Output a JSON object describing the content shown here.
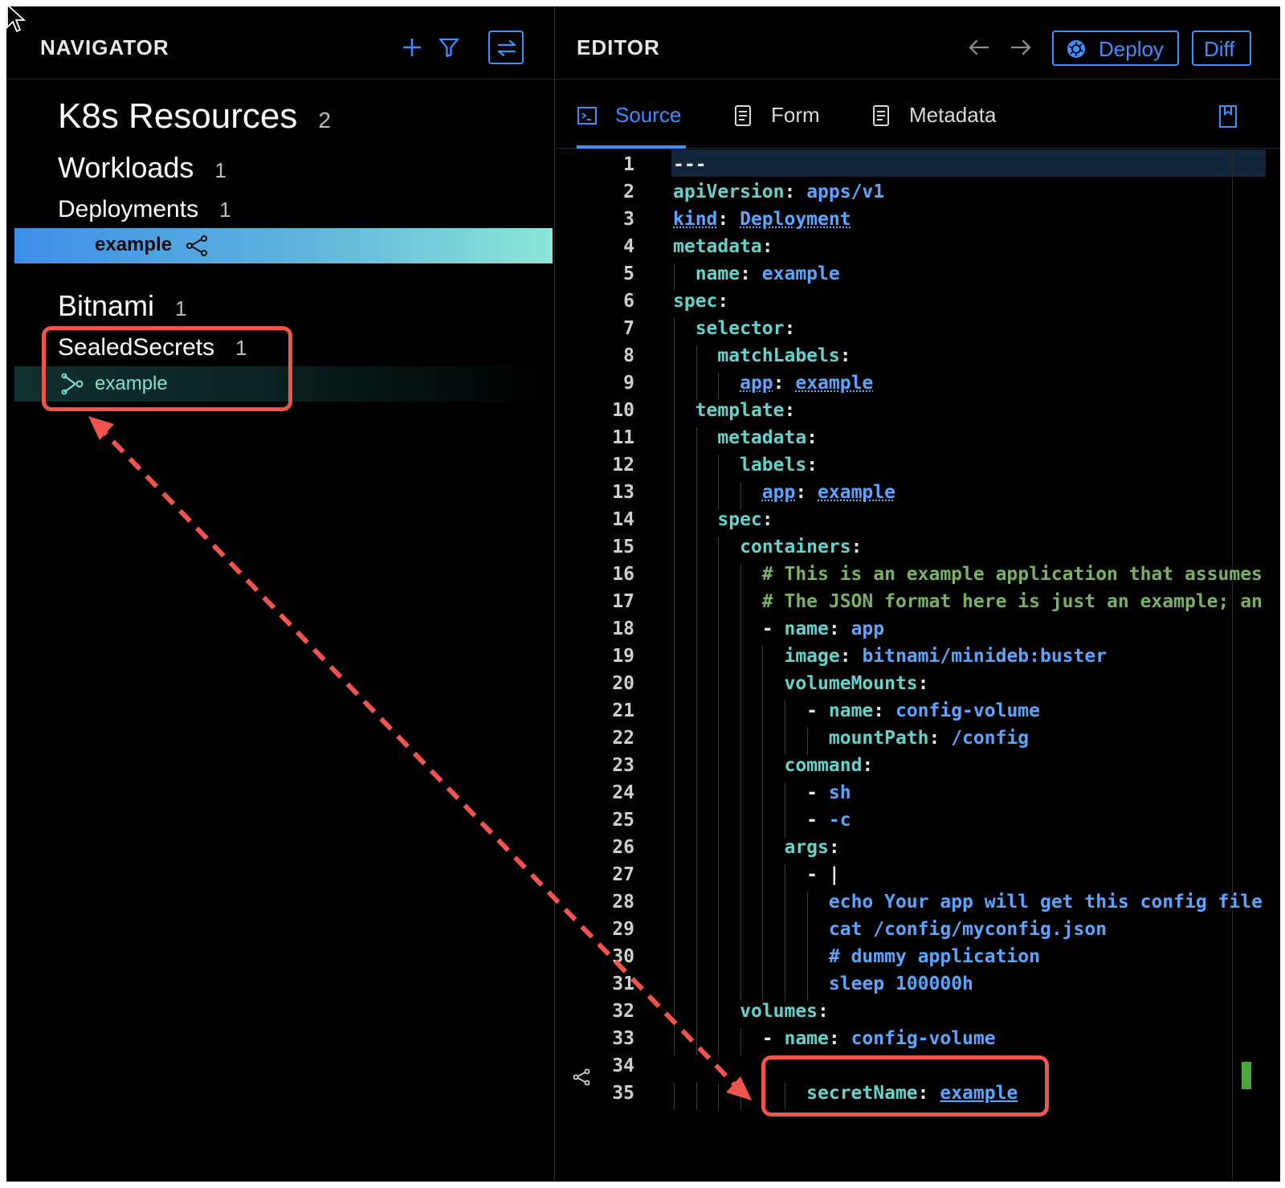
{
  "navigator": {
    "title": "NAVIGATOR",
    "section": {
      "title": "K8s Resources",
      "count": "2"
    },
    "groups": [
      {
        "title": "Workloads",
        "count": "1",
        "kinds": [
          {
            "title": "Deployments",
            "count": "1",
            "items": [
              "example"
            ]
          }
        ]
      },
      {
        "title": "Bitnami",
        "count": "1",
        "kinds": [
          {
            "title": "SealedSecrets",
            "count": "1",
            "items": [
              "example"
            ]
          }
        ]
      }
    ]
  },
  "editor": {
    "title": "EDITOR",
    "deploy_label": "Deploy",
    "diff_label": "Diff",
    "tabs": [
      {
        "label": "Source",
        "active": true
      },
      {
        "label": "Form",
        "active": false
      },
      {
        "label": "Metadata",
        "active": false
      }
    ],
    "lines": [
      {
        "n": "1",
        "segs": [
          [
            "p",
            "---"
          ]
        ]
      },
      {
        "n": "2",
        "segs": [
          [
            "k",
            "apiVersion"
          ],
          [
            "p",
            ": "
          ],
          [
            "v",
            "apps/v1"
          ]
        ]
      },
      {
        "n": "3",
        "segs": [
          [
            "u",
            "kind"
          ],
          [
            "p",
            ": "
          ],
          [
            "u",
            "Deployment"
          ]
        ]
      },
      {
        "n": "4",
        "segs": [
          [
            "k",
            "metadata"
          ],
          [
            "p",
            ":"
          ]
        ]
      },
      {
        "n": "5",
        "segs": [
          [
            "p",
            "  "
          ],
          [
            "k",
            "name"
          ],
          [
            "p",
            ": "
          ],
          [
            "v",
            "example"
          ]
        ]
      },
      {
        "n": "6",
        "segs": [
          [
            "k",
            "spec"
          ],
          [
            "p",
            ":"
          ]
        ]
      },
      {
        "n": "7",
        "segs": [
          [
            "p",
            "  "
          ],
          [
            "k",
            "selector"
          ],
          [
            "p",
            ":"
          ]
        ]
      },
      {
        "n": "8",
        "segs": [
          [
            "p",
            "    "
          ],
          [
            "k",
            "matchLabels"
          ],
          [
            "p",
            ":"
          ]
        ]
      },
      {
        "n": "9",
        "segs": [
          [
            "p",
            "      "
          ],
          [
            "u",
            "app"
          ],
          [
            "p",
            ": "
          ],
          [
            "u",
            "example"
          ]
        ]
      },
      {
        "n": "10",
        "segs": [
          [
            "p",
            "  "
          ],
          [
            "k",
            "template"
          ],
          [
            "p",
            ":"
          ]
        ]
      },
      {
        "n": "11",
        "segs": [
          [
            "p",
            "    "
          ],
          [
            "k",
            "metadata"
          ],
          [
            "p",
            ":"
          ]
        ]
      },
      {
        "n": "12",
        "segs": [
          [
            "p",
            "      "
          ],
          [
            "k",
            "labels"
          ],
          [
            "p",
            ":"
          ]
        ]
      },
      {
        "n": "13",
        "segs": [
          [
            "p",
            "        "
          ],
          [
            "u",
            "app"
          ],
          [
            "p",
            ": "
          ],
          [
            "u",
            "example"
          ]
        ]
      },
      {
        "n": "14",
        "segs": [
          [
            "p",
            "    "
          ],
          [
            "k",
            "spec"
          ],
          [
            "p",
            ":"
          ]
        ]
      },
      {
        "n": "15",
        "segs": [
          [
            "p",
            "      "
          ],
          [
            "k",
            "containers"
          ],
          [
            "p",
            ":"
          ]
        ]
      },
      {
        "n": "16",
        "segs": [
          [
            "p",
            "        "
          ],
          [
            "c",
            "# This is an example application that assumes"
          ]
        ]
      },
      {
        "n": "17",
        "segs": [
          [
            "p",
            "        "
          ],
          [
            "c",
            "# The JSON format here is just an example; an"
          ]
        ]
      },
      {
        "n": "18",
        "segs": [
          [
            "p",
            "        - "
          ],
          [
            "k",
            "name"
          ],
          [
            "p",
            ": "
          ],
          [
            "v",
            "app"
          ]
        ]
      },
      {
        "n": "19",
        "segs": [
          [
            "p",
            "          "
          ],
          [
            "k",
            "image"
          ],
          [
            "p",
            ": "
          ],
          [
            "v",
            "bitnami/minideb:buster"
          ]
        ]
      },
      {
        "n": "20",
        "segs": [
          [
            "p",
            "          "
          ],
          [
            "k",
            "volumeMounts"
          ],
          [
            "p",
            ":"
          ]
        ]
      },
      {
        "n": "21",
        "segs": [
          [
            "p",
            "            - "
          ],
          [
            "k",
            "name"
          ],
          [
            "p",
            ": "
          ],
          [
            "v",
            "config-volume"
          ]
        ]
      },
      {
        "n": "22",
        "segs": [
          [
            "p",
            "              "
          ],
          [
            "k",
            "mountPath"
          ],
          [
            "p",
            ": "
          ],
          [
            "v",
            "/config"
          ]
        ]
      },
      {
        "n": "23",
        "segs": [
          [
            "p",
            "          "
          ],
          [
            "k",
            "command"
          ],
          [
            "p",
            ":"
          ]
        ]
      },
      {
        "n": "24",
        "segs": [
          [
            "p",
            "            - "
          ],
          [
            "v",
            "sh"
          ]
        ]
      },
      {
        "n": "25",
        "segs": [
          [
            "p",
            "            - "
          ],
          [
            "v",
            "-c"
          ]
        ]
      },
      {
        "n": "26",
        "segs": [
          [
            "p",
            "          "
          ],
          [
            "k",
            "args"
          ],
          [
            "p",
            ":"
          ]
        ]
      },
      {
        "n": "27",
        "segs": [
          [
            "p",
            "            - |"
          ]
        ]
      },
      {
        "n": "28",
        "segs": [
          [
            "p",
            "              "
          ],
          [
            "v",
            "echo Your app will get this config file"
          ]
        ]
      },
      {
        "n": "29",
        "segs": [
          [
            "p",
            "              "
          ],
          [
            "v",
            "cat /config/myconfig.json"
          ]
        ]
      },
      {
        "n": "30",
        "segs": [
          [
            "p",
            "              "
          ],
          [
            "v",
            "# dummy application"
          ]
        ]
      },
      {
        "n": "31",
        "segs": [
          [
            "p",
            "              "
          ],
          [
            "v",
            "sleep 100000h"
          ]
        ]
      },
      {
        "n": "32",
        "segs": [
          [
            "p",
            "      "
          ],
          [
            "k",
            "volumes"
          ],
          [
            "p",
            ":"
          ]
        ]
      },
      {
        "n": "33",
        "segs": [
          [
            "p",
            "        - "
          ],
          [
            "k",
            "name"
          ],
          [
            "p",
            ": "
          ],
          [
            "v",
            "config-volume"
          ]
        ]
      },
      {
        "n": "34",
        "segs": []
      },
      {
        "n": "35",
        "segs": [
          [
            "p",
            "            "
          ],
          [
            "k",
            "secretName"
          ],
          [
            "p",
            ": "
          ],
          [
            "lnk",
            "example"
          ]
        ]
      }
    ]
  },
  "colors": {
    "accent": "#3b8fff",
    "callout": "#f0544c",
    "key": "#62d4cc",
    "value": "#58a6ff",
    "comment": "#78b35f"
  }
}
